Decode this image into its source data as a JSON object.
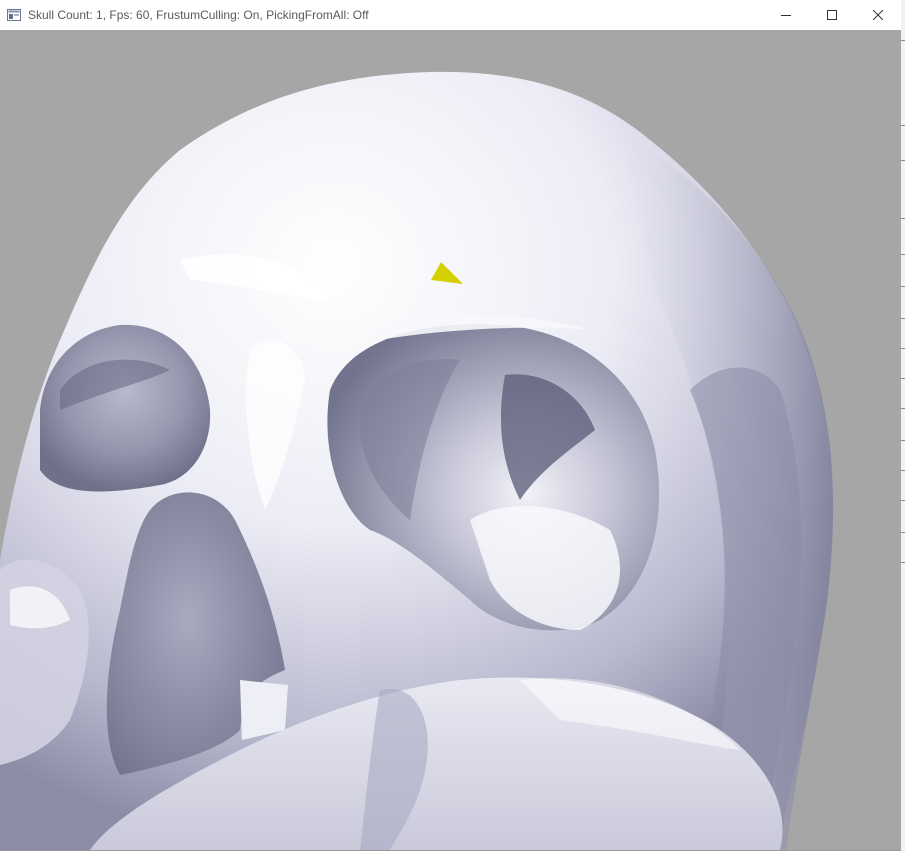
{
  "window": {
    "title": "Skull Count: 1, Fps: 60, FrustumCulling: On, PickingFromAll: Off",
    "icon": "app-window-icon",
    "caption_buttons": [
      {
        "name": "minimize-button",
        "icon": "minimize-icon"
      },
      {
        "name": "maximize-button",
        "icon": "maximize-icon"
      },
      {
        "name": "close-button",
        "icon": "close-icon"
      }
    ]
  },
  "scene": {
    "background_color": "#a6a6a6",
    "mesh": "skull",
    "mesh_color": "#e6e6f5",
    "picked_triangle_color": "#d4d000"
  }
}
